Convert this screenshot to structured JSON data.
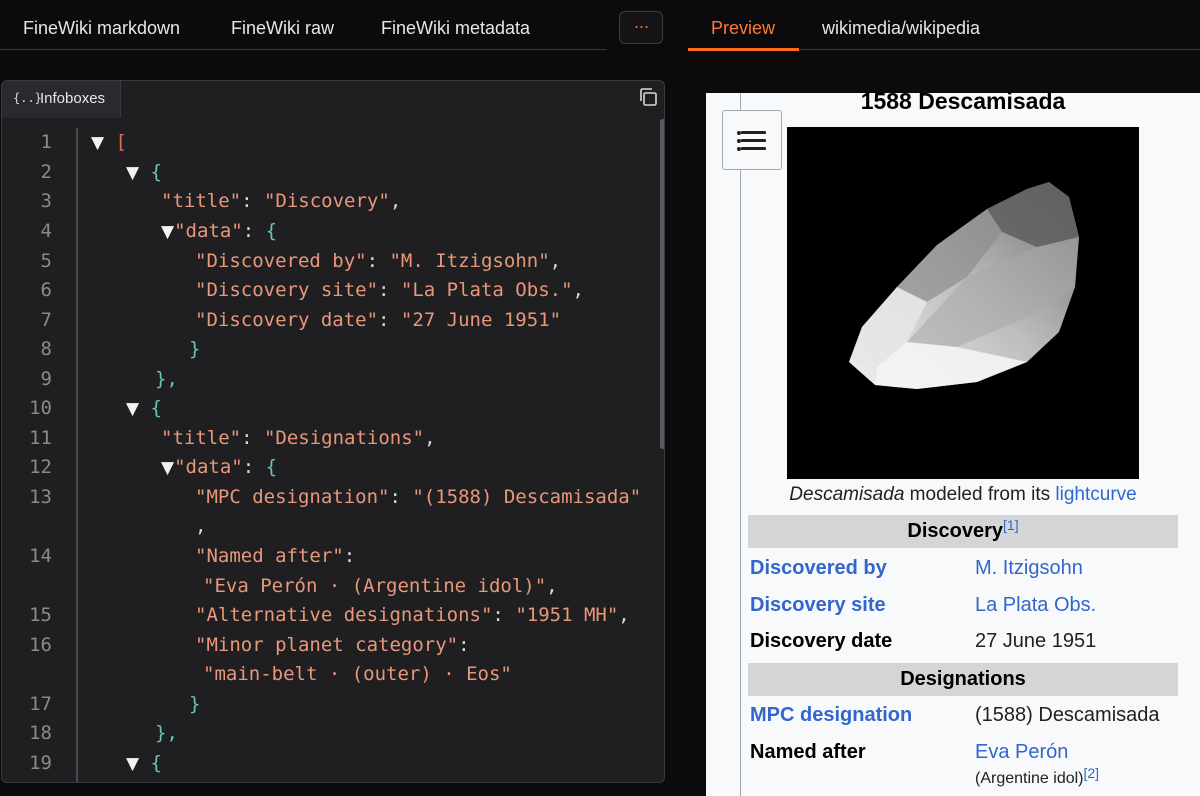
{
  "tabs": {
    "markdown": "FineWiki markdown",
    "raw": "FineWiki raw",
    "metadata": "FineWiki metadata",
    "more": "···",
    "preview": "Preview",
    "source": "wikimedia/wikipedia"
  },
  "code": {
    "tab_label": "Infoboxes",
    "braces_icon": "{..}",
    "line_numbers": [
      "1",
      "2",
      "3",
      "4",
      "5",
      "6",
      "7",
      "8",
      "9",
      "10",
      "11",
      "12",
      "13",
      "14",
      "15",
      "16",
      "17",
      "18",
      "19"
    ],
    "tokens": {
      "open_bracket": "[",
      "open_brace": "{",
      "close_brace": "}",
      "close_brace_comma": "},",
      "colon_space": ": ",
      "comma": ",",
      "triangle": "▼",
      "title_key": "\"title\"",
      "data_key": "\"data\"",
      "discovery_title": "\"Discovery\"",
      "discovered_by_key": "\"Discovered by\"",
      "discovered_by_val": "\"M. Itzigsohn\"",
      "discovery_site_key": "\"Discovery site\"",
      "discovery_site_val": "\"La Plata Obs.\"",
      "discovery_date_key": "\"Discovery date\"",
      "discovery_date_val": "\"27 June 1951\"",
      "designations_title": "\"Designations\"",
      "mpc_key": "\"MPC designation\"",
      "mpc_val": "\"(1588) Descamisada\"",
      "named_after_key": "\"Named after\"",
      "named_after_val": "\"Eva Perón · (Argentine idol)\"",
      "alt_key": "\"Alternative designations\"",
      "alt_val": "\"1951 MH\"",
      "category_key": "\"Minor planet category\"",
      "category_val": "\"main-belt · (outer) · Eos\""
    }
  },
  "preview": {
    "title": "1588 Descamisada",
    "caption_italic": "Descamisada",
    "caption_mid": " modeled from its ",
    "caption_link": "lightcurve",
    "discovery_header": "Discovery",
    "discovery_ref": "[1]",
    "discovered_by_label": "Discovered by",
    "discovered_by_value": "M. Itzigsohn",
    "discovery_site_label": "Discovery site",
    "discovery_site_value": "La Plata Obs.",
    "discovery_date_label": "Discovery date",
    "discovery_date_value": "27 June 1951",
    "designations_header": "Designations",
    "mpc_label": "MPC designation",
    "mpc_value": "(1588) Descamisada",
    "named_after_label": "Named after",
    "named_after_value": "Eva Perón",
    "named_after_sub": "(Argentine idol)",
    "named_after_ref": "[2]"
  },
  "colors": {
    "accent": "#ff6a1a",
    "link": "#3366cc",
    "code_key": "#e8977a",
    "code_brace": "#6cc5b0"
  }
}
